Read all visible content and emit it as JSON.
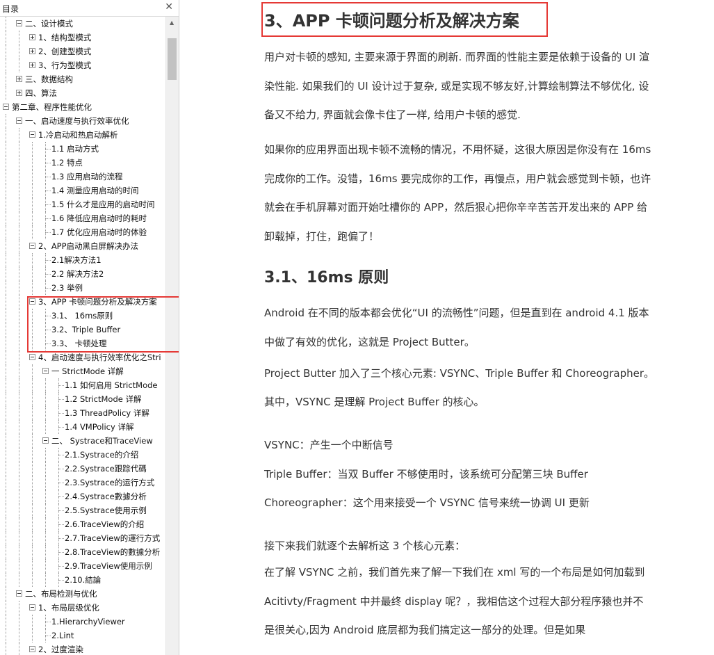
{
  "toc": {
    "title": "目录",
    "close_icon": "✕",
    "items": [
      {
        "label": "二、设计模式",
        "level": 1,
        "expander": "minus"
      },
      {
        "label": "1、结构型模式",
        "level": 2,
        "expander": "plus"
      },
      {
        "label": "2、创建型模式",
        "level": 2,
        "expander": "plus"
      },
      {
        "label": "3、行为型模式",
        "level": 2,
        "expander": "plus"
      },
      {
        "label": "三、数据结构",
        "level": 1,
        "expander": "plus"
      },
      {
        "label": "四、算法",
        "level": 1,
        "expander": "plus"
      },
      {
        "label": "第二章、程序性能优化",
        "level": 0,
        "expander": "minus"
      },
      {
        "label": "一、启动速度与执行效率优化",
        "level": 1,
        "expander": "minus"
      },
      {
        "label": "1.冷启动和热启动解析",
        "level": 2,
        "expander": "minus"
      },
      {
        "label": "1.1 启动方式",
        "level": 3,
        "expander": "none"
      },
      {
        "label": "1.2 特点",
        "level": 3,
        "expander": "none"
      },
      {
        "label": "1.3 应用启动的流程",
        "level": 3,
        "expander": "none"
      },
      {
        "label": "1.4 测量应用启动的时间",
        "level": 3,
        "expander": "none"
      },
      {
        "label": "1.5 什么才是应用的启动时间",
        "level": 3,
        "expander": "none"
      },
      {
        "label": "1.6 降低应用启动时的耗时",
        "level": 3,
        "expander": "none"
      },
      {
        "label": "1.7 优化应用启动时的体验",
        "level": 3,
        "expander": "none"
      },
      {
        "label": "2、APP启动黑白屏解决办法",
        "level": 2,
        "expander": "minus"
      },
      {
        "label": "2.1解决方法1",
        "level": 3,
        "expander": "none"
      },
      {
        "label": "2.2 解决方法2",
        "level": 3,
        "expander": "none"
      },
      {
        "label": "2.3 举例",
        "level": 3,
        "expander": "none"
      },
      {
        "label": "3、APP 卡顿问题分析及解决方案",
        "level": 2,
        "expander": "minus"
      },
      {
        "label": "3.1、 16ms原则",
        "level": 3,
        "expander": "none"
      },
      {
        "label": "3.2、Triple Buffer",
        "level": 3,
        "expander": "none"
      },
      {
        "label": "3.3、 卡顿处理",
        "level": 3,
        "expander": "none"
      },
      {
        "label": "4、启动速度与执行效率优化之Stri",
        "level": 2,
        "expander": "minus"
      },
      {
        "label": "一 StrictMode 详解",
        "level": 3,
        "expander": "minus"
      },
      {
        "label": "1.1 如何启用 StrictMode",
        "level": 4,
        "expander": "none"
      },
      {
        "label": "1.2 StrictMode 详解",
        "level": 4,
        "expander": "none"
      },
      {
        "label": "1.3 ThreadPolicy 详解",
        "level": 4,
        "expander": "none"
      },
      {
        "label": "1.4 VMPolicy 详解",
        "level": 4,
        "expander": "none"
      },
      {
        "label": "二、 Systrace和TraceView",
        "level": 3,
        "expander": "minus"
      },
      {
        "label": "2.1.Systrace的介绍",
        "level": 4,
        "expander": "none"
      },
      {
        "label": "2.2.Systrace跟踪代碼",
        "level": 4,
        "expander": "none"
      },
      {
        "label": "2.3.Systrace的运行方式",
        "level": 4,
        "expander": "none"
      },
      {
        "label": "2.4.Systrace數據分析",
        "level": 4,
        "expander": "none"
      },
      {
        "label": "2.5.Systrace使用示例",
        "level": 4,
        "expander": "none"
      },
      {
        "label": "2.6.TraceView的介绍",
        "level": 4,
        "expander": "none"
      },
      {
        "label": "2.7.TraceView的運行方式",
        "level": 4,
        "expander": "none"
      },
      {
        "label": "2.8.TraceView的數據分析",
        "level": 4,
        "expander": "none"
      },
      {
        "label": "2.9.TraceView使用示例",
        "level": 4,
        "expander": "none"
      },
      {
        "label": "2.10.結論",
        "level": 4,
        "expander": "none"
      },
      {
        "label": "二、布局检测与优化",
        "level": 1,
        "expander": "minus"
      },
      {
        "label": "1、布局层级优化",
        "level": 2,
        "expander": "minus"
      },
      {
        "label": "1.HierarchyViewer",
        "level": 3,
        "expander": "none"
      },
      {
        "label": "2.Lint",
        "level": 3,
        "expander": "none"
      },
      {
        "label": "2、过度渲染",
        "level": 2,
        "expander": "minus"
      }
    ]
  },
  "doc": {
    "title": "3、APP  卡顿问题分析及解决方案",
    "intro_para1": "用户对卡顿的感知, 主要来源于界面的刷新. 而界面的性能主要是依赖于设备的 UI 渲染性能. 如果我们的 UI 设计过于复杂, 或是实现不够友好,计算绘制算法不够优化, 设备又不给力, 界面就会像卡住了一样, 给用户卡顿的感觉.",
    "intro_para2": "如果你的应用界面出现卡顿不流畅的情况，不用怀疑，这很大原因是你没有在 16ms 完成你的工作。没错，16ms 要完成你的工作，再慢点，用户就会感觉到卡顿，也许就会在手机屏幕对面开始吐槽你的 APP，然后狠心把你辛辛苦苦开发出来的 APP 给卸载掉，打住，跑偏了！",
    "subtitle": "3.1、16ms 原则",
    "android_para": "Android  在不同的版本都会优化“UI 的流畅性”问题，但是直到在 android 4.1 版本中做了有效的优化，这就是 Project Butter。",
    "butter_line1": "Project Butter  加入了三个核心元素: VSYNC、Triple Buffer  和  Choreographer。",
    "butter_line2": "其中，VSYNC  是理解 Project Buffer 的核心。",
    "vsync_line": "VSYNC：产生一个中断信号",
    "triple_line": "Triple Buffer：当双  Buffer  不够使用时，该系统可分配第三块  Buffer",
    "chor_line": "Choreographer：这个用来接受一个  VSYNC  信号来统一协调 UI 更新",
    "next_line": "接下来我们就逐个去解析这 3 个核心元素：",
    "final_para": "在了解 VSYNC 之前，我们首先来了解一下我们在  xml  写的一个布局是如何加载到 Acitivty/Fragment 中并最终  display  呢？，我相信这个过程大部分程序猿也并不是很关心,因为  Android  底层都为我们搞定这一部分的处理。但是如果"
  }
}
